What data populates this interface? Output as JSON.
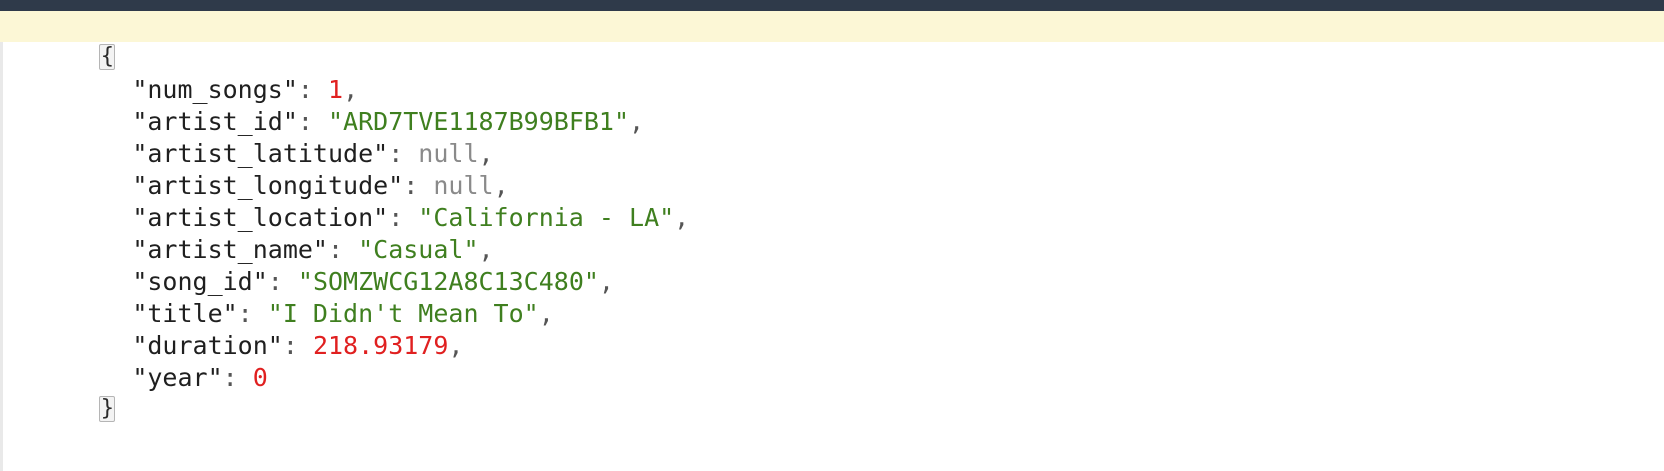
{
  "editor": {
    "open_brace": "{",
    "close_brace": "}",
    "entries": [
      {
        "key": "\"num_songs\"",
        "value": "1",
        "type": "number",
        "comma": ","
      },
      {
        "key": "\"artist_id\"",
        "value": "\"ARD7TVE1187B99BFB1\"",
        "type": "string",
        "comma": ","
      },
      {
        "key": "\"artist_latitude\"",
        "value": "null",
        "type": "null",
        "comma": ","
      },
      {
        "key": "\"artist_longitude\"",
        "value": "null",
        "type": "null",
        "comma": ","
      },
      {
        "key": "\"artist_location\"",
        "value": "\"California - LA\"",
        "type": "string",
        "comma": ","
      },
      {
        "key": "\"artist_name\"",
        "value": "\"Casual\"",
        "type": "string",
        "comma": ","
      },
      {
        "key": "\"song_id\"",
        "value": "\"SOMZWCG12A8C13C480\"",
        "type": "string",
        "comma": ","
      },
      {
        "key": "\"title\"",
        "value": "\"I Didn't Mean To\"",
        "type": "string",
        "comma": ","
      },
      {
        "key": "\"duration\"",
        "value": "218.93179",
        "type": "number",
        "comma": ","
      },
      {
        "key": "\"year\"",
        "value": "0",
        "type": "number",
        "comma": ""
      }
    ],
    "colon": ": ",
    "colors": {
      "string": "#3f7f1f",
      "number": "#e02020",
      "null": "#8a8a8a",
      "active_line": "#fcf7d6",
      "topbar": "#2f3a4a"
    }
  }
}
